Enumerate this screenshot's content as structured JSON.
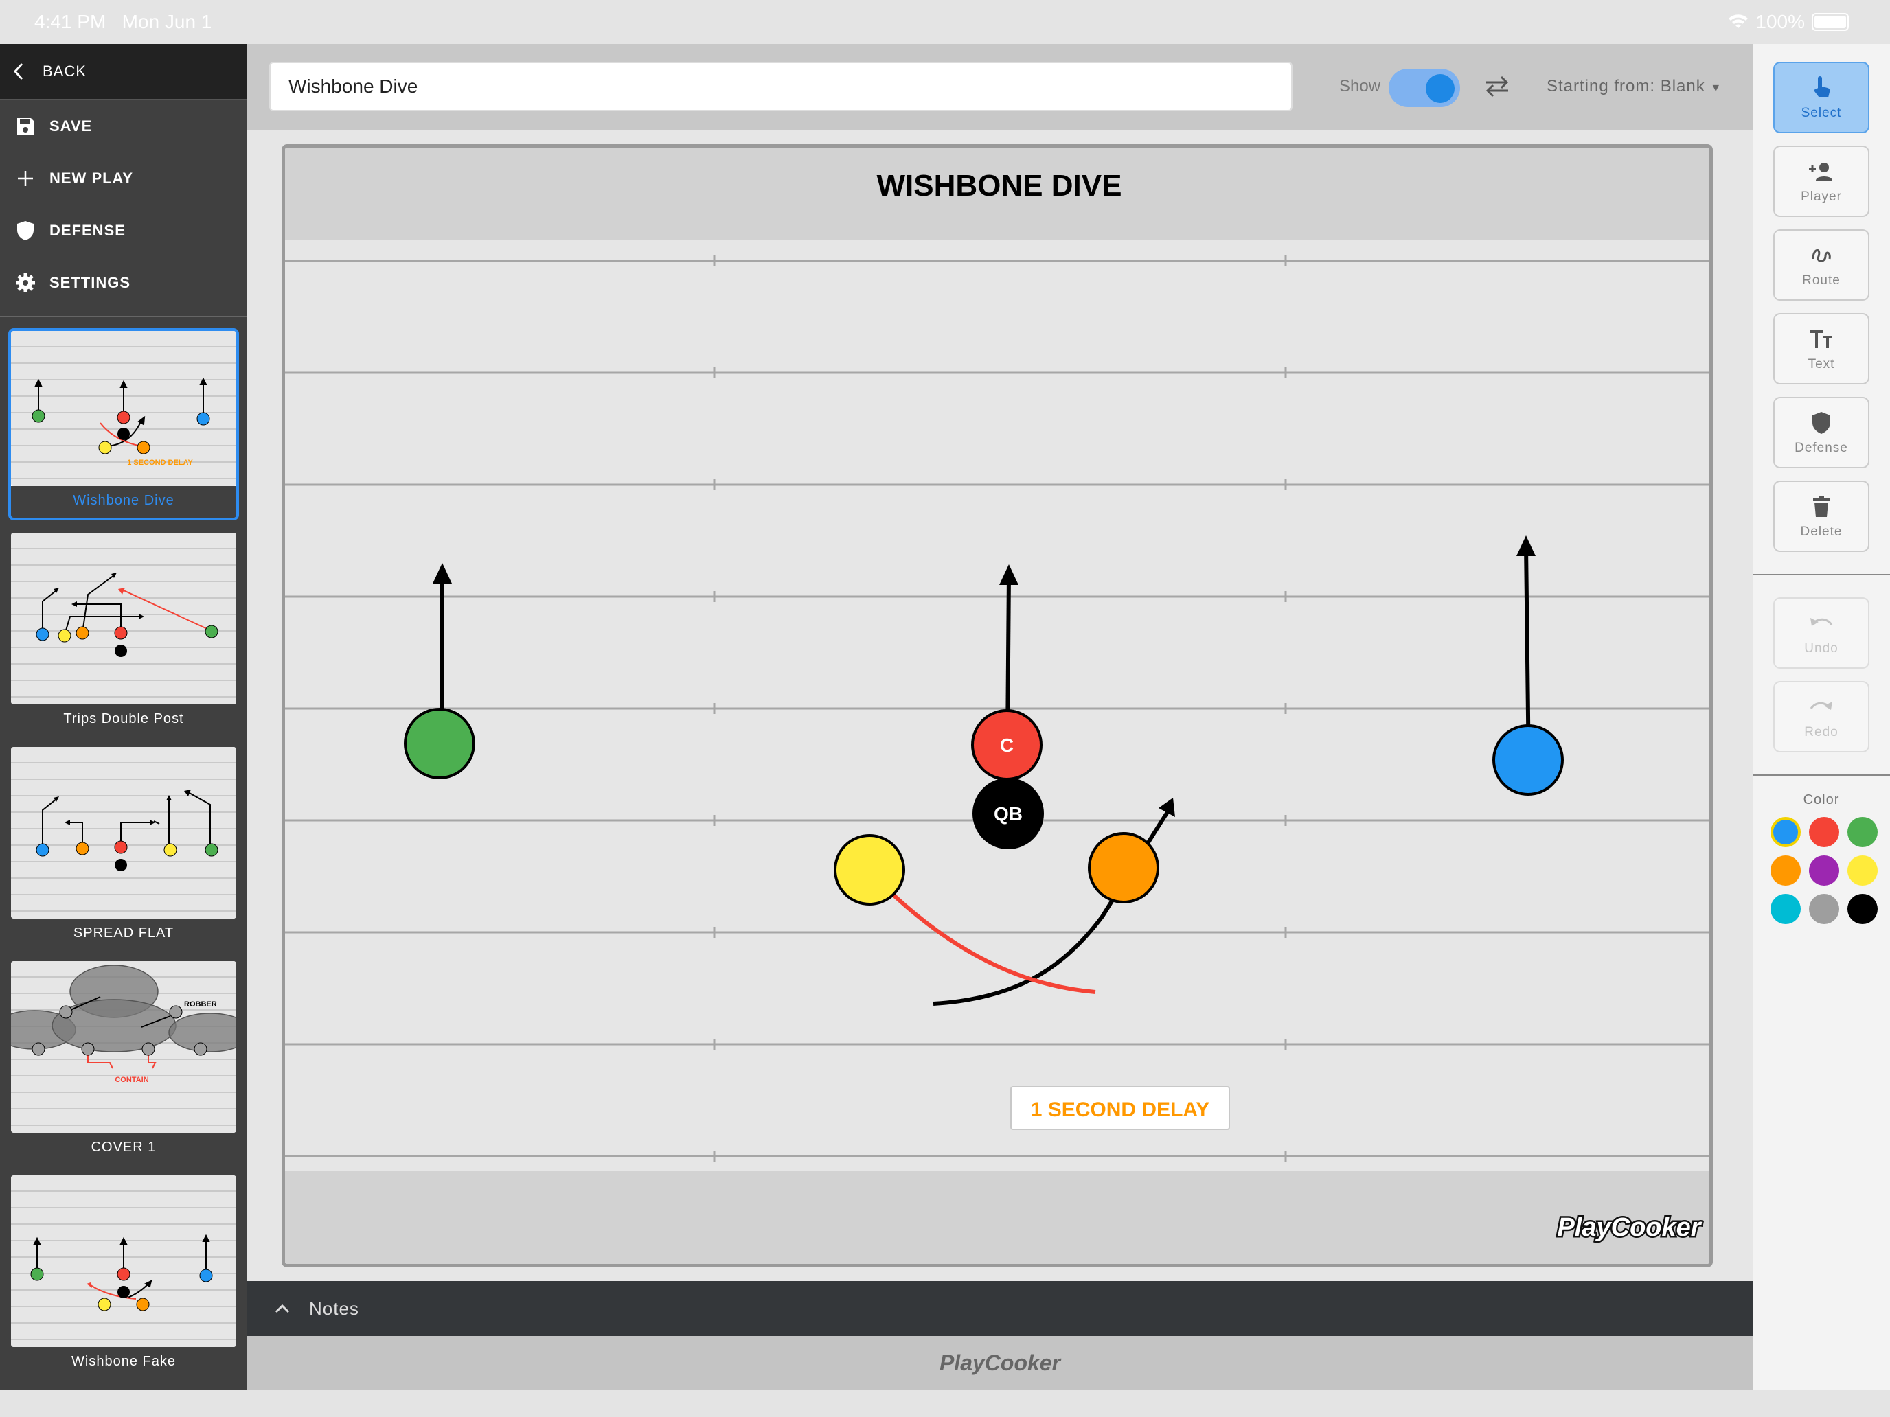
{
  "status": {
    "time": "4:41 PM",
    "date": "Mon Jun 1",
    "battery": "100%"
  },
  "sidebar": {
    "back": "BACK",
    "menu": [
      {
        "label": "SAVE",
        "icon": "save-icon"
      },
      {
        "label": "NEW PLAY",
        "icon": "plus-icon"
      },
      {
        "label": "DEFENSE",
        "icon": "shield-icon"
      },
      {
        "label": "SETTINGS",
        "icon": "gear-icon"
      }
    ],
    "plays": [
      {
        "label": "Wishbone Dive",
        "active": true,
        "thumb_text": "1 SECOND DELAY"
      },
      {
        "label": "Trips Double Post",
        "active": false
      },
      {
        "label": "SPREAD FLAT",
        "active": false
      },
      {
        "label": "COVER 1",
        "active": false,
        "thumb_text": [
          "ROBBER",
          "CONTAIN"
        ]
      },
      {
        "label": "Wishbone Fake",
        "active": false
      }
    ]
  },
  "topbar": {
    "play_name": "Wishbone Dive",
    "show_label": "Show",
    "show_on": true,
    "starting_from": "Starting from: Blank"
  },
  "field": {
    "title": "WISHBONE DIVE",
    "players": [
      {
        "label": "",
        "color": "#4caf50"
      },
      {
        "label": "C",
        "color": "#f44336"
      },
      {
        "label": "",
        "color": "#2196f3"
      },
      {
        "label": "QB",
        "color": "#000000"
      },
      {
        "label": "",
        "color": "#ffeb3b"
      },
      {
        "label": "",
        "color": "#ff9800"
      }
    ],
    "annotation": "1 SECOND DELAY",
    "annotation_color": "#ff9800",
    "watermark": "PlayCooker"
  },
  "notes": {
    "label": "Notes"
  },
  "footer": {
    "brand": "PlayCooker"
  },
  "toolbar": {
    "tools": [
      {
        "label": "Select",
        "icon": "hand-pointer-icon",
        "selected": true
      },
      {
        "label": "Player",
        "icon": "add-person-icon"
      },
      {
        "label": "Route",
        "icon": "route-icon"
      },
      {
        "label": "Text",
        "icon": "text-size-icon"
      },
      {
        "label": "Defense",
        "icon": "shield-icon"
      },
      {
        "label": "Delete",
        "icon": "trash-icon"
      }
    ],
    "history": [
      {
        "label": "Undo",
        "icon": "undo-icon",
        "enabled": false
      },
      {
        "label": "Redo",
        "icon": "redo-icon",
        "enabled": false
      }
    ],
    "color_label": "Color",
    "colors": [
      "#2196f3",
      "#f44336",
      "#4caf50",
      "#ff9800",
      "#9c27b0",
      "#ffeb3b",
      "#00bcd4",
      "#9e9e9e",
      "#000000"
    ],
    "selected_color": "#2196f3"
  }
}
